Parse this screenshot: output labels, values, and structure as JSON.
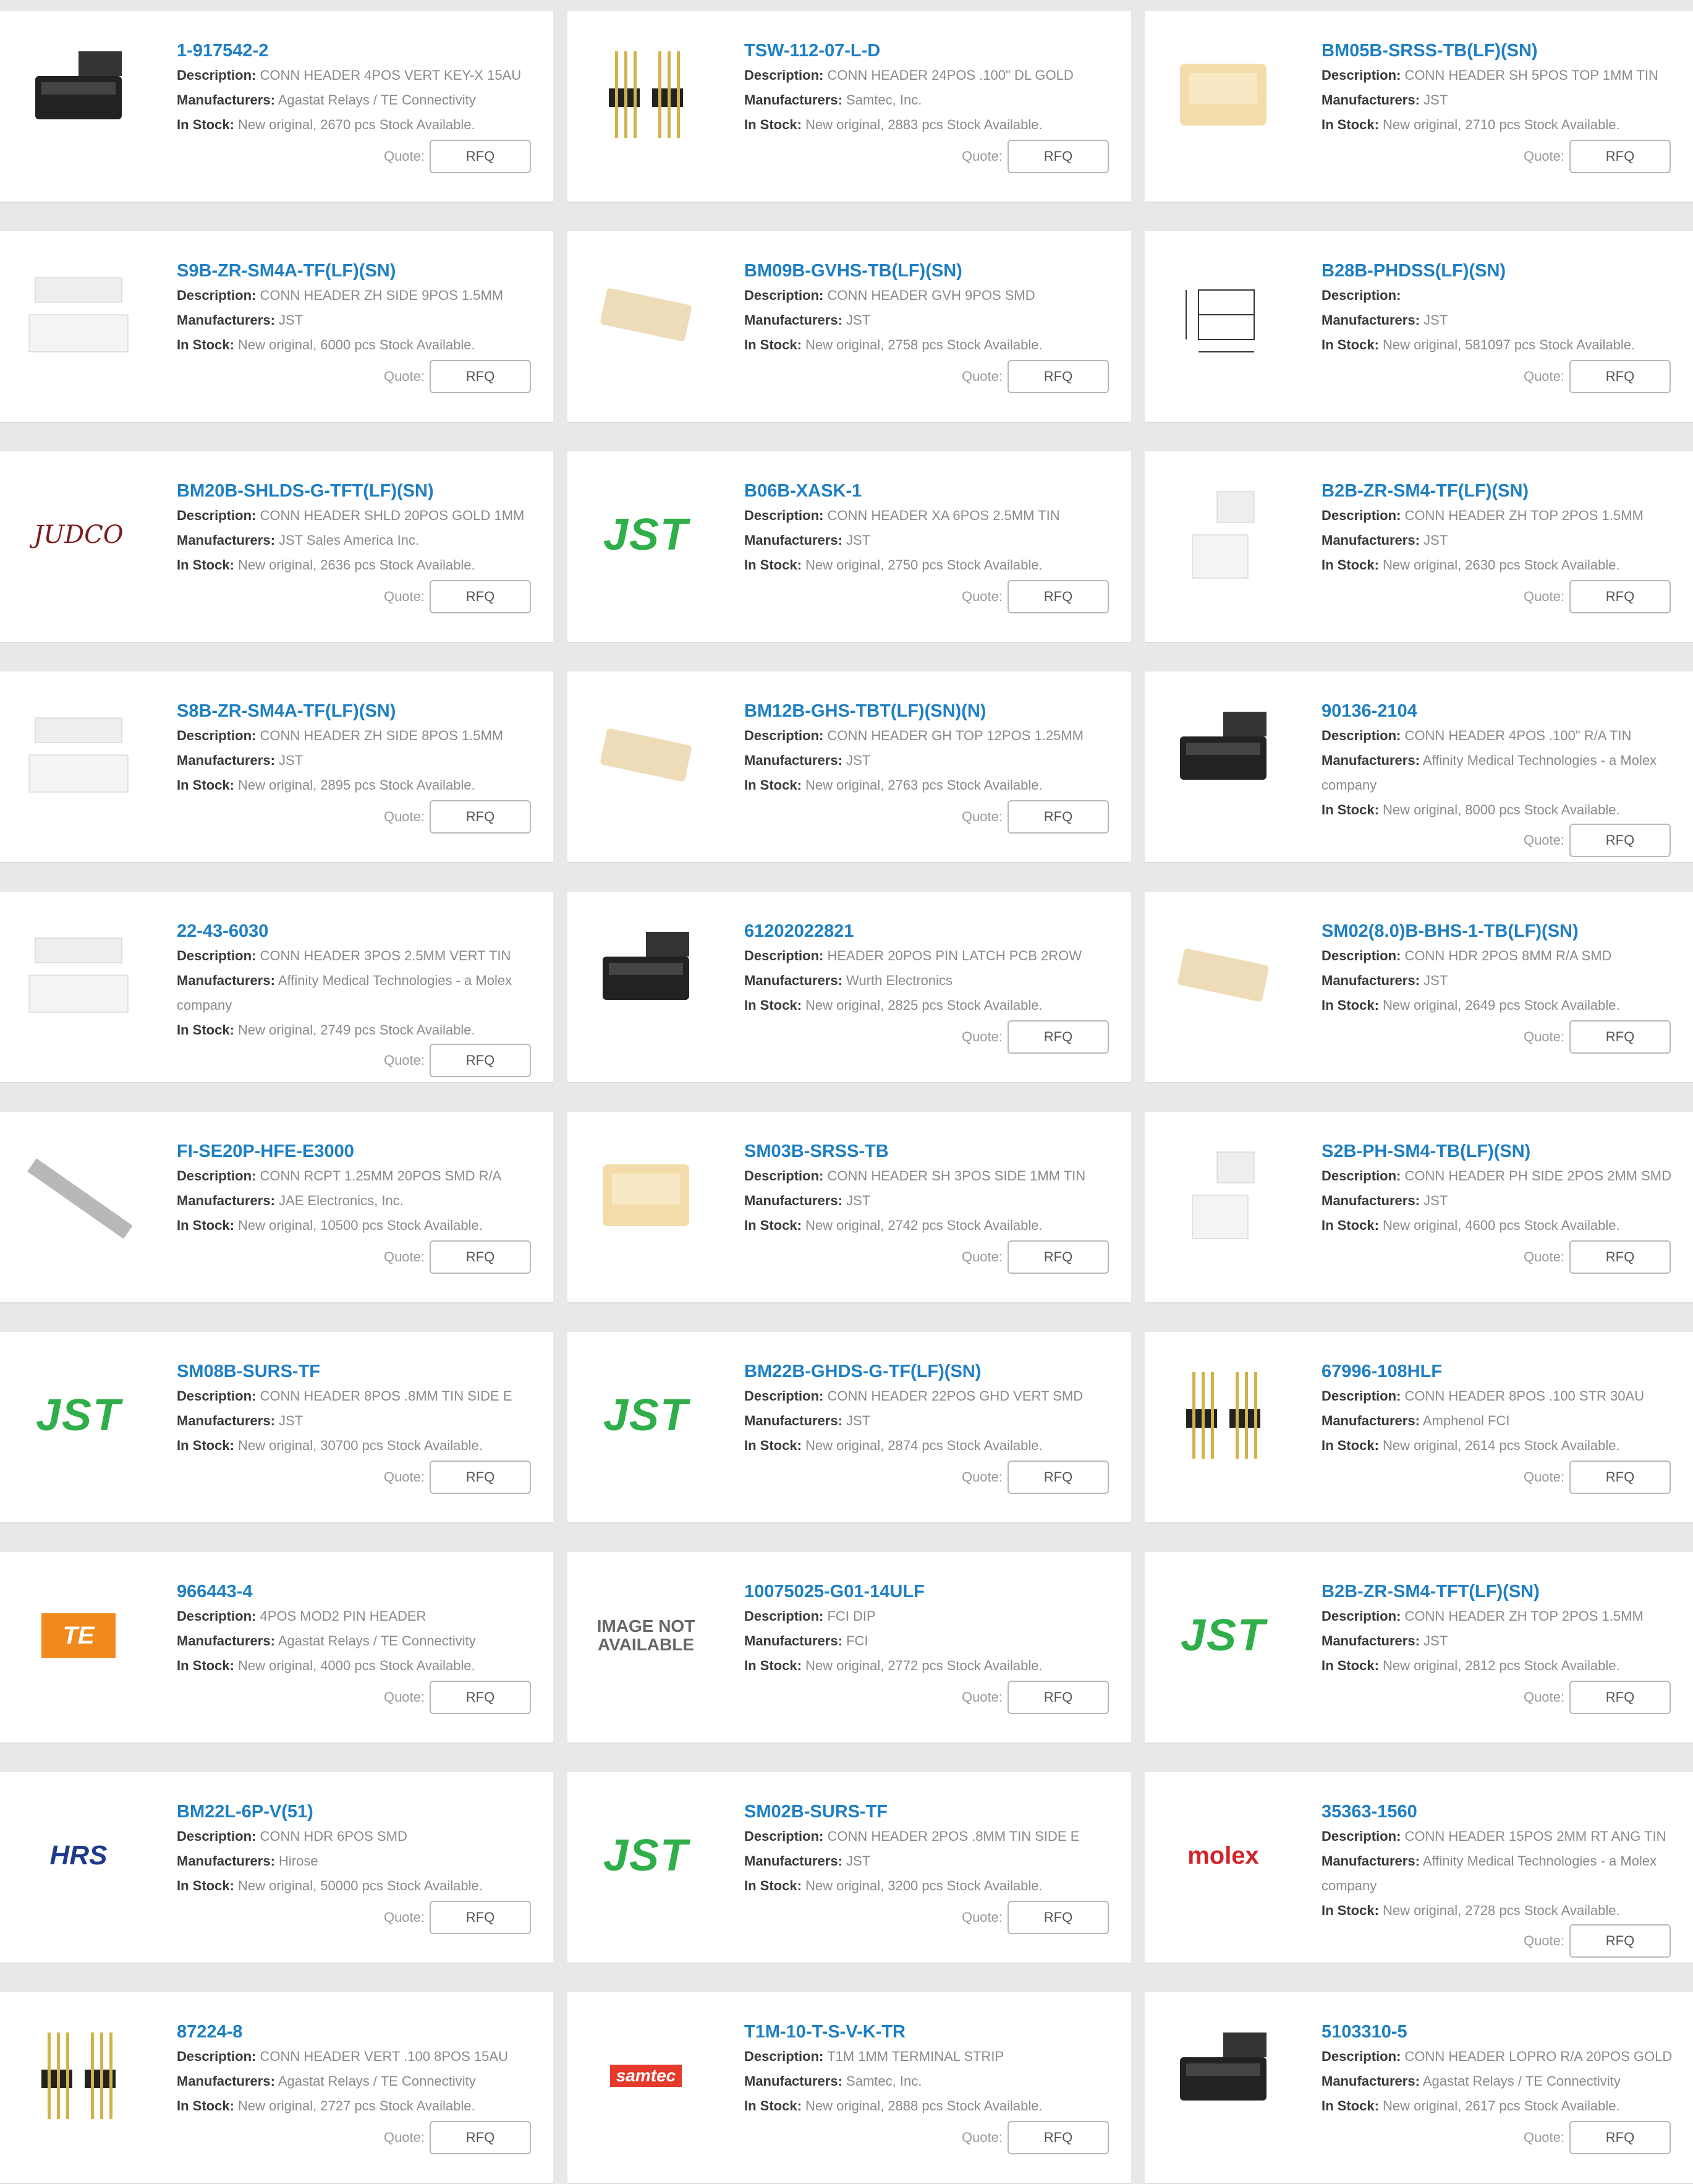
{
  "labels": {
    "description": "Description:",
    "manufacturers": "Manufacturers:",
    "in_stock": "In Stock:",
    "quote": "Quote:",
    "rfq": "RFQ"
  },
  "products": [
    {
      "pn": "1-917542-2",
      "desc": "CONN HEADER 4POS VERT KEY-X 15AU",
      "mfr": "Agastat Relays / TE Connectivity",
      "stock": "New original, 2670 pcs Stock Available.",
      "image": "black-header-photo"
    },
    {
      "pn": "TSW-112-07-L-D",
      "desc": "CONN HEADER 24POS .100\" DL GOLD",
      "mfr": "Samtec, Inc.",
      "stock": "New original, 2883 pcs Stock Available.",
      "image": "pin-header-photo"
    },
    {
      "pn": "BM05B-SRSS-TB(LF)(SN)",
      "desc": "CONN HEADER SH 5POS TOP 1MM TIN",
      "mfr": "JST",
      "stock": "New original, 2710 pcs Stock Available.",
      "image": "beige-header-photo"
    },
    {
      "pn": "S9B-ZR-SM4A-TF(LF)(SN)",
      "desc": "CONN HEADER ZH SIDE 9POS 1.5MM",
      "mfr": "JST",
      "stock": "New original, 6000 pcs Stock Available.",
      "image": "white-header-photo"
    },
    {
      "pn": "BM09B-GVHS-TB(LF)(SN)",
      "desc": "CONN HEADER GVH 9POS SMD",
      "mfr": "JST",
      "stock": "New original, 2758 pcs Stock Available.",
      "image": "beige-smd-photo"
    },
    {
      "pn": "B28B-PHDSS(LF)(SN)",
      "desc": "",
      "mfr": "JST",
      "stock": "New original, 581097 pcs Stock Available.",
      "image": "dimension-drawing"
    },
    {
      "pn": "BM20B-SHLDS-G-TFT(LF)(SN)",
      "desc": "CONN HEADER SHLD 20POS GOLD 1MM",
      "mfr": "JST Sales America Inc.",
      "stock": "New original, 2636 pcs Stock Available.",
      "image": "judco-logo",
      "logo": "JUDCO"
    },
    {
      "pn": "B06B-XASK-1",
      "desc": "CONN HEADER XA 6POS 2.5MM TIN",
      "mfr": "JST",
      "stock": "New original, 2750 pcs Stock Available.",
      "image": "jst-logo",
      "logo": "JST"
    },
    {
      "pn": "B2B-ZR-SM4-TF(LF)(SN)",
      "desc": "CONN HEADER ZH TOP 2POS 1.5MM",
      "mfr": "JST",
      "stock": "New original, 2630 pcs Stock Available.",
      "image": "small-white-header-photo"
    },
    {
      "pn": "S8B-ZR-SM4A-TF(LF)(SN)",
      "desc": "CONN HEADER ZH SIDE 8POS 1.5MM",
      "mfr": "JST",
      "stock": "New original, 2895 pcs Stock Available.",
      "image": "white-header-photo"
    },
    {
      "pn": "BM12B-GHS-TBT(LF)(SN)(N)",
      "desc": "CONN HEADER GH TOP 12POS 1.25MM",
      "mfr": "JST",
      "stock": "New original, 2763 pcs Stock Available.",
      "image": "beige-smd-photo"
    },
    {
      "pn": "90136-2104",
      "desc": "CONN HEADER 4POS .100\" R/A TIN",
      "mfr": "Affinity Medical Technologies - a Molex company",
      "stock": "New original, 8000 pcs Stock Available.",
      "image": "black-header-photo"
    },
    {
      "pn": "22-43-6030",
      "desc": "CONN HEADER 3POS 2.5MM VERT TIN",
      "mfr": "Affinity Medical Technologies - a Molex company",
      "stock": "New original, 2749 pcs Stock Available.",
      "image": "white-header-photo"
    },
    {
      "pn": "61202022821",
      "desc": "HEADER 20POS PIN LATCH PCB 2ROW",
      "mfr": "Wurth Electronics",
      "stock": "New original, 2825 pcs Stock Available.",
      "image": "black-header-photo"
    },
    {
      "pn": "SM02(8.0)B-BHS-1-TB(LF)(SN)",
      "desc": "CONN HDR 2POS 8MM R/A SMD",
      "mfr": "JST",
      "stock": "New original, 2649 pcs Stock Available.",
      "image": "beige-smd-photo"
    },
    {
      "pn": "FI-SE20P-HFE-E3000",
      "desc": "CONN RCPT 1.25MM 20POS SMD R/A",
      "mfr": "JAE Electronics, Inc.",
      "stock": "New original, 10500 pcs Stock Available.",
      "image": "long-connector-photo"
    },
    {
      "pn": "SM03B-SRSS-TB",
      "desc": "CONN HEADER SH 3POS SIDE 1MM TIN",
      "mfr": "JST",
      "stock": "New original, 2742 pcs Stock Available.",
      "image": "beige-header-photo"
    },
    {
      "pn": "S2B-PH-SM4-TB(LF)(SN)",
      "desc": "CONN HEADER PH SIDE 2POS 2MM SMD",
      "mfr": "JST",
      "stock": "New original, 4600 pcs Stock Available.",
      "image": "small-white-header-photo"
    },
    {
      "pn": "SM08B-SURS-TF",
      "desc": "CONN HEADER 8POS .8MM TIN SIDE E",
      "mfr": "JST",
      "stock": "New original, 30700 pcs Stock Available.",
      "image": "jst-logo",
      "logo": "JST"
    },
    {
      "pn": "BM22B-GHDS-G-TF(LF)(SN)",
      "desc": "CONN HEADER 22POS GHD VERT SMD",
      "mfr": "JST",
      "stock": "New original, 2874 pcs Stock Available.",
      "image": "jst-logo",
      "logo": "JST"
    },
    {
      "pn": "67996-108HLF",
      "desc": "CONN HEADER 8POS .100 STR 30AU",
      "mfr": "Amphenol FCI",
      "stock": "New original, 2614 pcs Stock Available.",
      "image": "pin-header-photo"
    },
    {
      "pn": "966443-4",
      "desc": "4POS MOD2 PIN HEADER",
      "mfr": "Agastat Relays / TE Connectivity",
      "stock": "New original, 4000 pcs Stock Available.",
      "image": "te-logo",
      "logo": "TE"
    },
    {
      "pn": "10075025-G01-14ULF",
      "desc": "FCI DIP",
      "mfr": "FCI",
      "stock": "New original, 2772 pcs Stock Available.",
      "image": "image-not-available",
      "logo": "IMAGE NOT AVAILABLE"
    },
    {
      "pn": "B2B-ZR-SM4-TFT(LF)(SN)",
      "desc": "CONN HEADER ZH TOP 2POS 1.5MM",
      "mfr": "JST",
      "stock": "New original, 2812 pcs Stock Available.",
      "image": "jst-logo",
      "logo": "JST"
    },
    {
      "pn": "BM22L-6P-V(51)",
      "desc": "CONN HDR 6POS SMD",
      "mfr": "Hirose",
      "stock": "New original, 50000 pcs Stock Available.",
      "image": "hirose-logo",
      "logo": "HRS"
    },
    {
      "pn": "SM02B-SURS-TF",
      "desc": "CONN HEADER 2POS .8MM TIN SIDE E",
      "mfr": "JST",
      "stock": "New original, 3200 pcs Stock Available.",
      "image": "jst-logo",
      "logo": "JST"
    },
    {
      "pn": "35363-1560",
      "desc": "CONN HEADER 15POS 2MM RT ANG TIN",
      "mfr": "Affinity Medical Technologies - a Molex company",
      "stock": "New original, 2728 pcs Stock Available.",
      "image": "molex-logo",
      "logo": "molex"
    },
    {
      "pn": "87224-8",
      "desc": "CONN HEADER VERT .100 8POS 15AU",
      "mfr": "Agastat Relays / TE Connectivity",
      "stock": "New original, 2727 pcs Stock Available.",
      "image": "pin-header-photo"
    },
    {
      "pn": "T1M-10-T-S-V-K-TR",
      "desc": "T1M 1MM TERMINAL STRIP",
      "mfr": "Samtec, Inc.",
      "stock": "New original, 2888 pcs Stock Available.",
      "image": "samtec-logo",
      "logo": "samtec"
    },
    {
      "pn": "5103310-5",
      "desc": "CONN HEADER LOPRO R/A 20POS GOLD",
      "mfr": "Agastat Relays / TE Connectivity",
      "stock": "New original, 2617 pcs Stock Available.",
      "image": "black-header-photo"
    }
  ],
  "colors": {
    "link": "#1e7fc4",
    "jst": "#2fae49",
    "molex": "#d2232a",
    "samtec": "#e53a2c",
    "te": "#f08a1c"
  }
}
